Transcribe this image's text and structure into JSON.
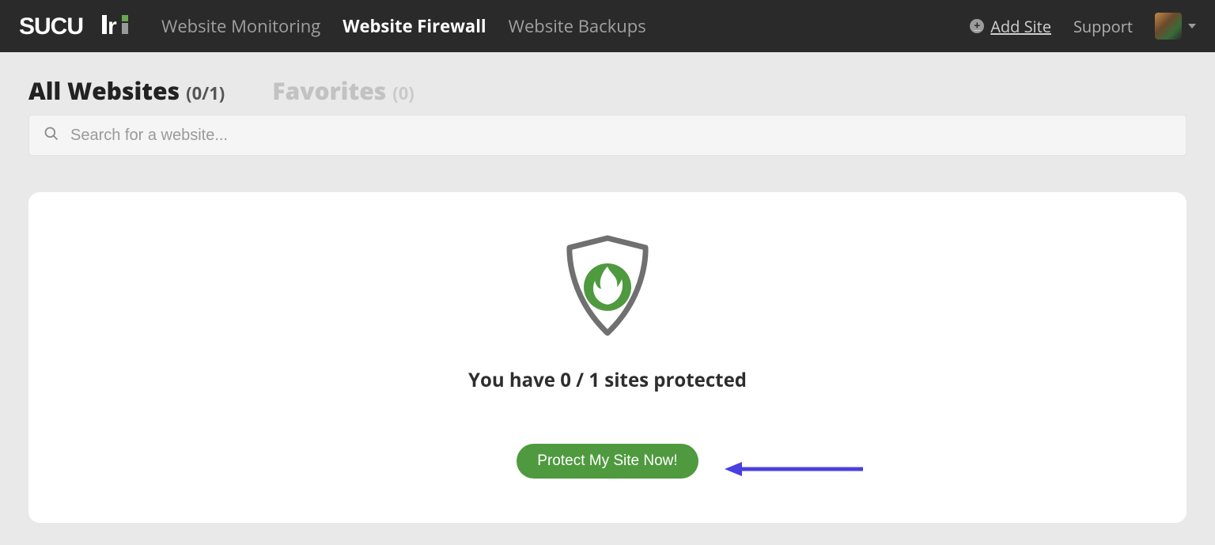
{
  "nav": {
    "monitoring": "Website Monitoring",
    "firewall": "Website Firewall",
    "backups": "Website Backups",
    "add_site": "Add Site",
    "support": "Support"
  },
  "tabs": {
    "all_label": "All Websites",
    "all_count": "(0/1)",
    "fav_label": "Favorites",
    "fav_count": "(0)"
  },
  "search": {
    "placeholder": "Search for a website..."
  },
  "main": {
    "status": "You have 0 / 1 sites protected",
    "cta": "Protect My Site Now!"
  }
}
